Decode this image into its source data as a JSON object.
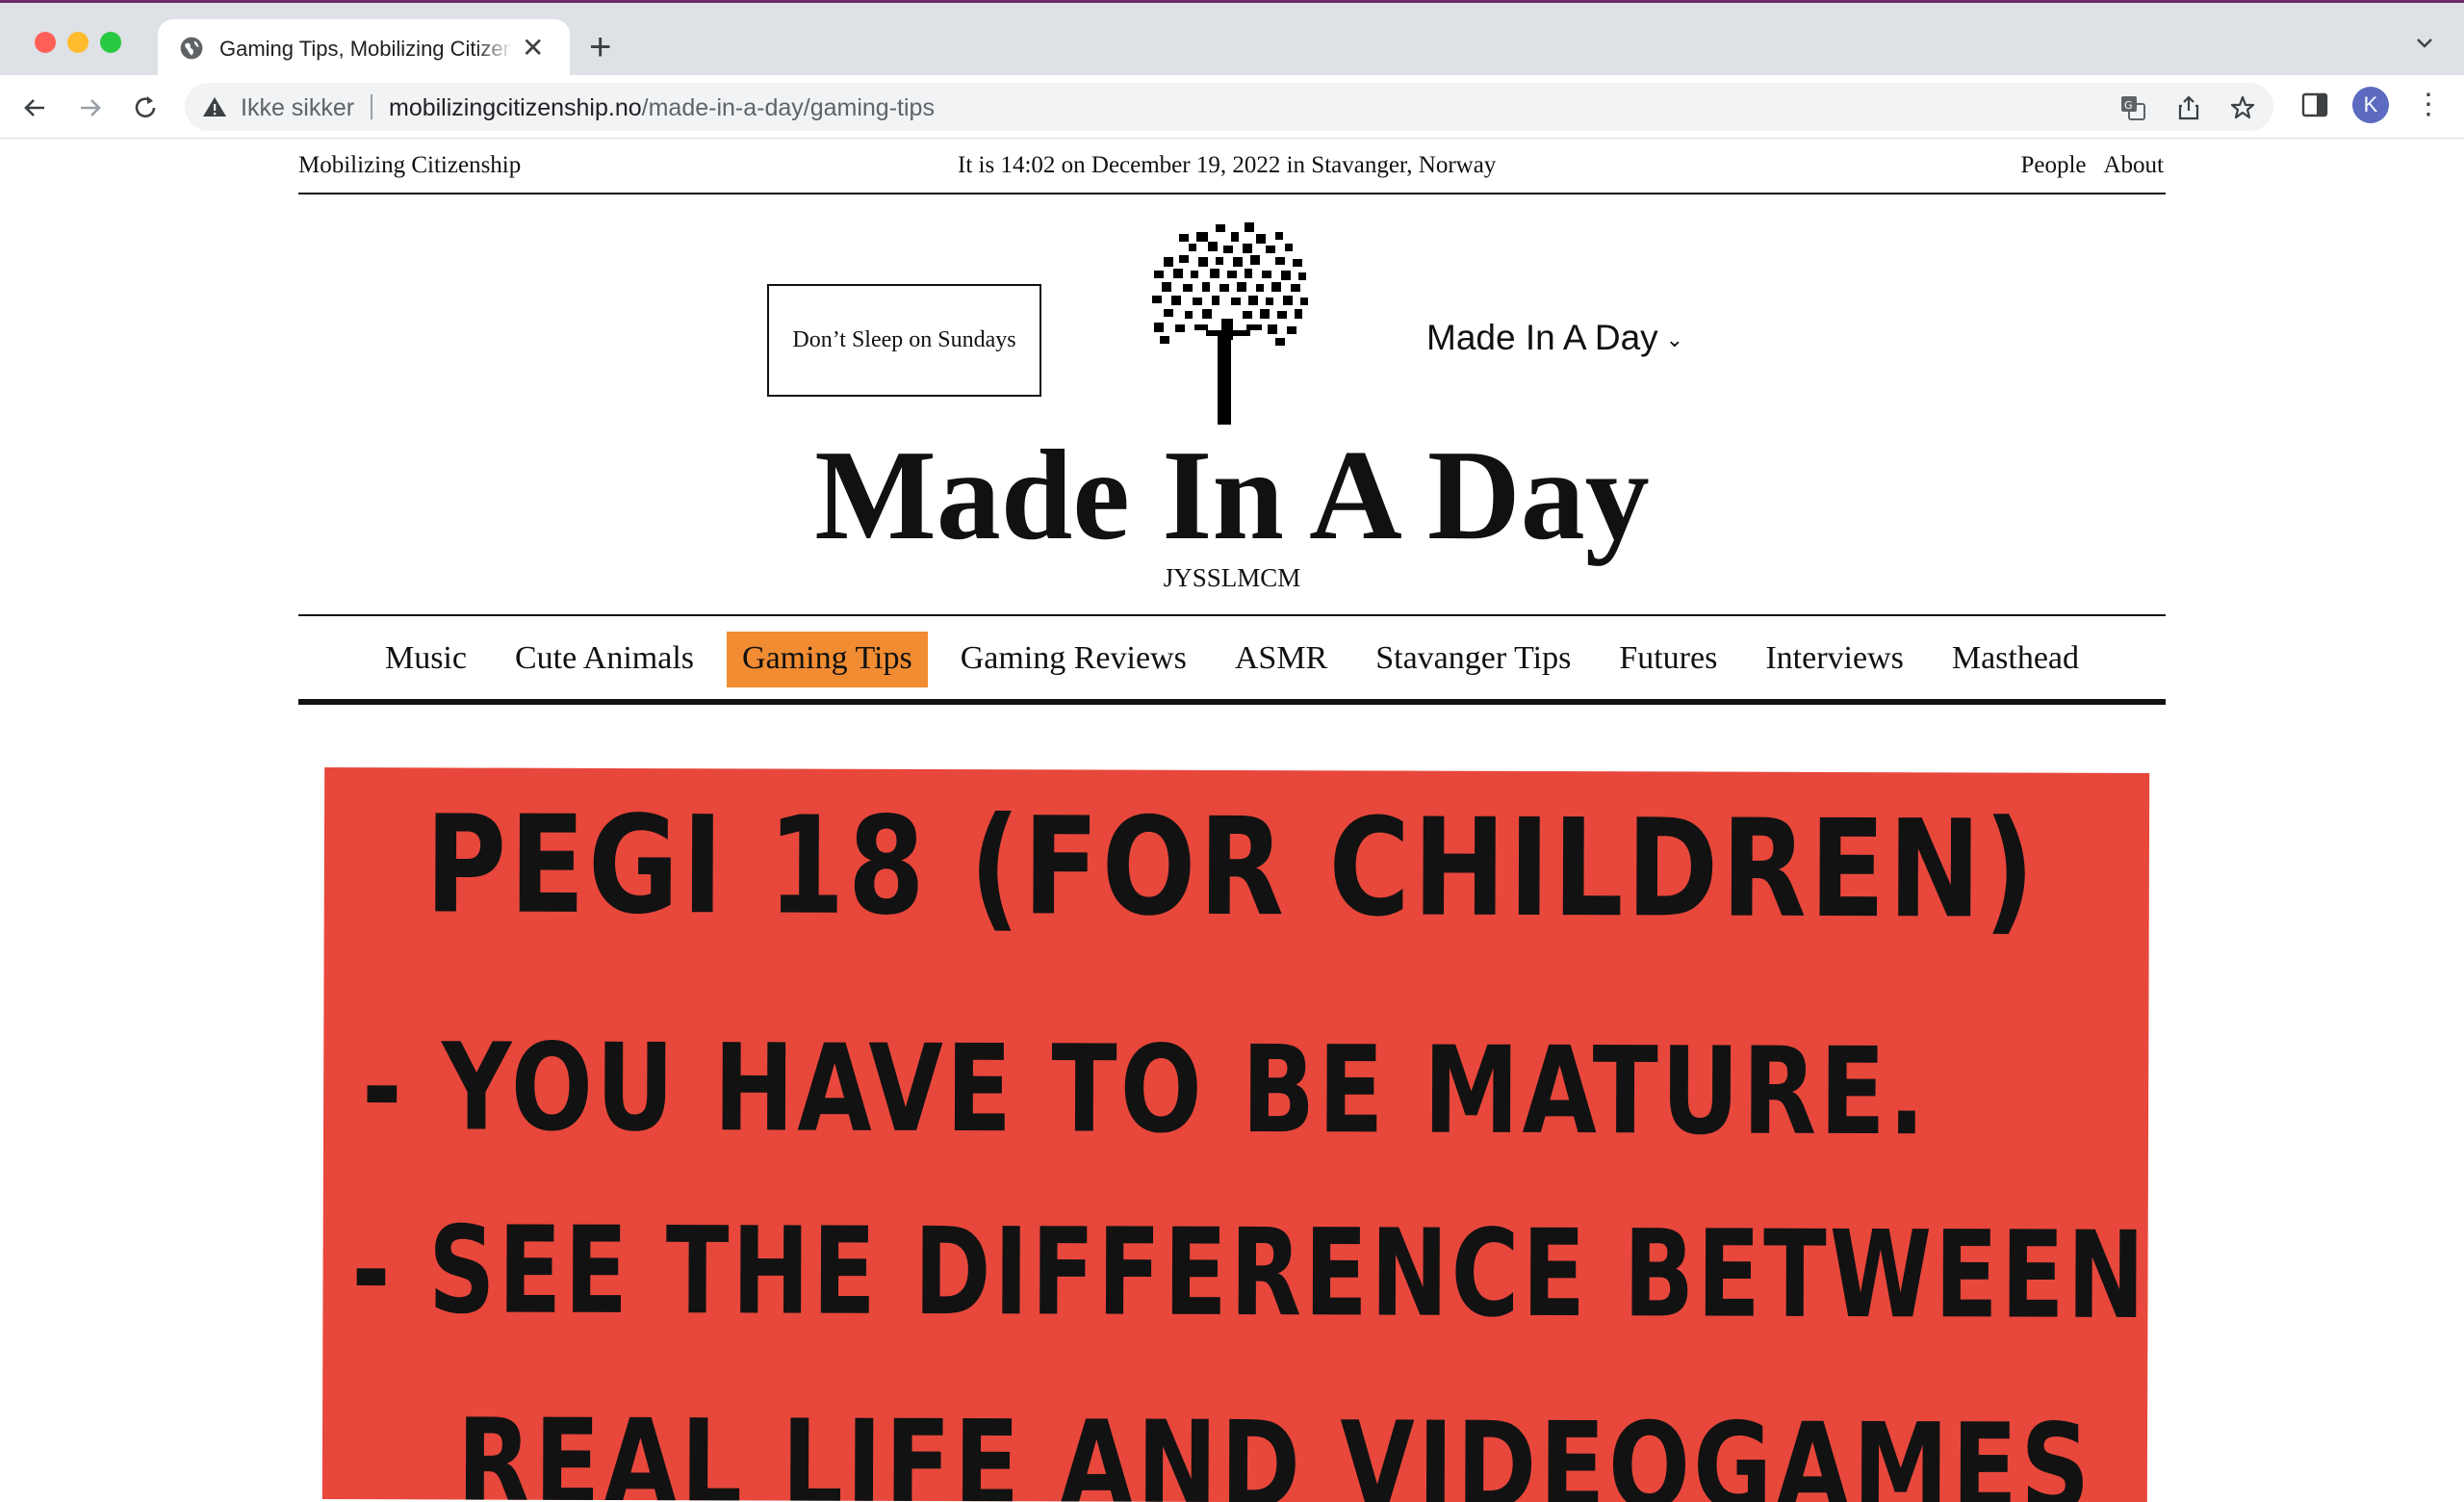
{
  "browser": {
    "tab_title": "Gaming Tips, Mobilizing Citizenship",
    "new_tab": "+",
    "close": "✕",
    "security_label": "Ikke sikker",
    "url_host": "mobilizingcitizenship.no",
    "url_path": "/made-in-a-day/gaming-tips",
    "profile_initial": "K",
    "menu": "⋮"
  },
  "header": {
    "site_name": "Mobilizing Citizenship",
    "date_line": "It is 14:02 on December 19, 2022 in Stavanger, Norway",
    "links": [
      "People",
      "About"
    ]
  },
  "masthead": {
    "button_label": "Don’t Sleep on Sundays",
    "section_selector": "Made In A Day",
    "chevron": "⌄",
    "title": "Made In A Day",
    "subtitle": "JYSSLMCM"
  },
  "nav": {
    "items": [
      "Music",
      "Cute Animals",
      "Gaming Tips",
      "Gaming Reviews",
      "ASMR",
      "Stavanger Tips",
      "Futures",
      "Interviews",
      "Masthead"
    ],
    "active": "Gaming Tips"
  },
  "article": {
    "lines": [
      "PEGI 18 (FOR CHILDREN)",
      "- YOU  HAVE TO BE MATURE.",
      "- SEE  THE DIFFERENCE BETWEEN",
      "REAL  LIFE  AND  VIDEOGAMES"
    ]
  },
  "colors": {
    "active_nav": "#f18c32",
    "card_background": "#e8473c"
  }
}
